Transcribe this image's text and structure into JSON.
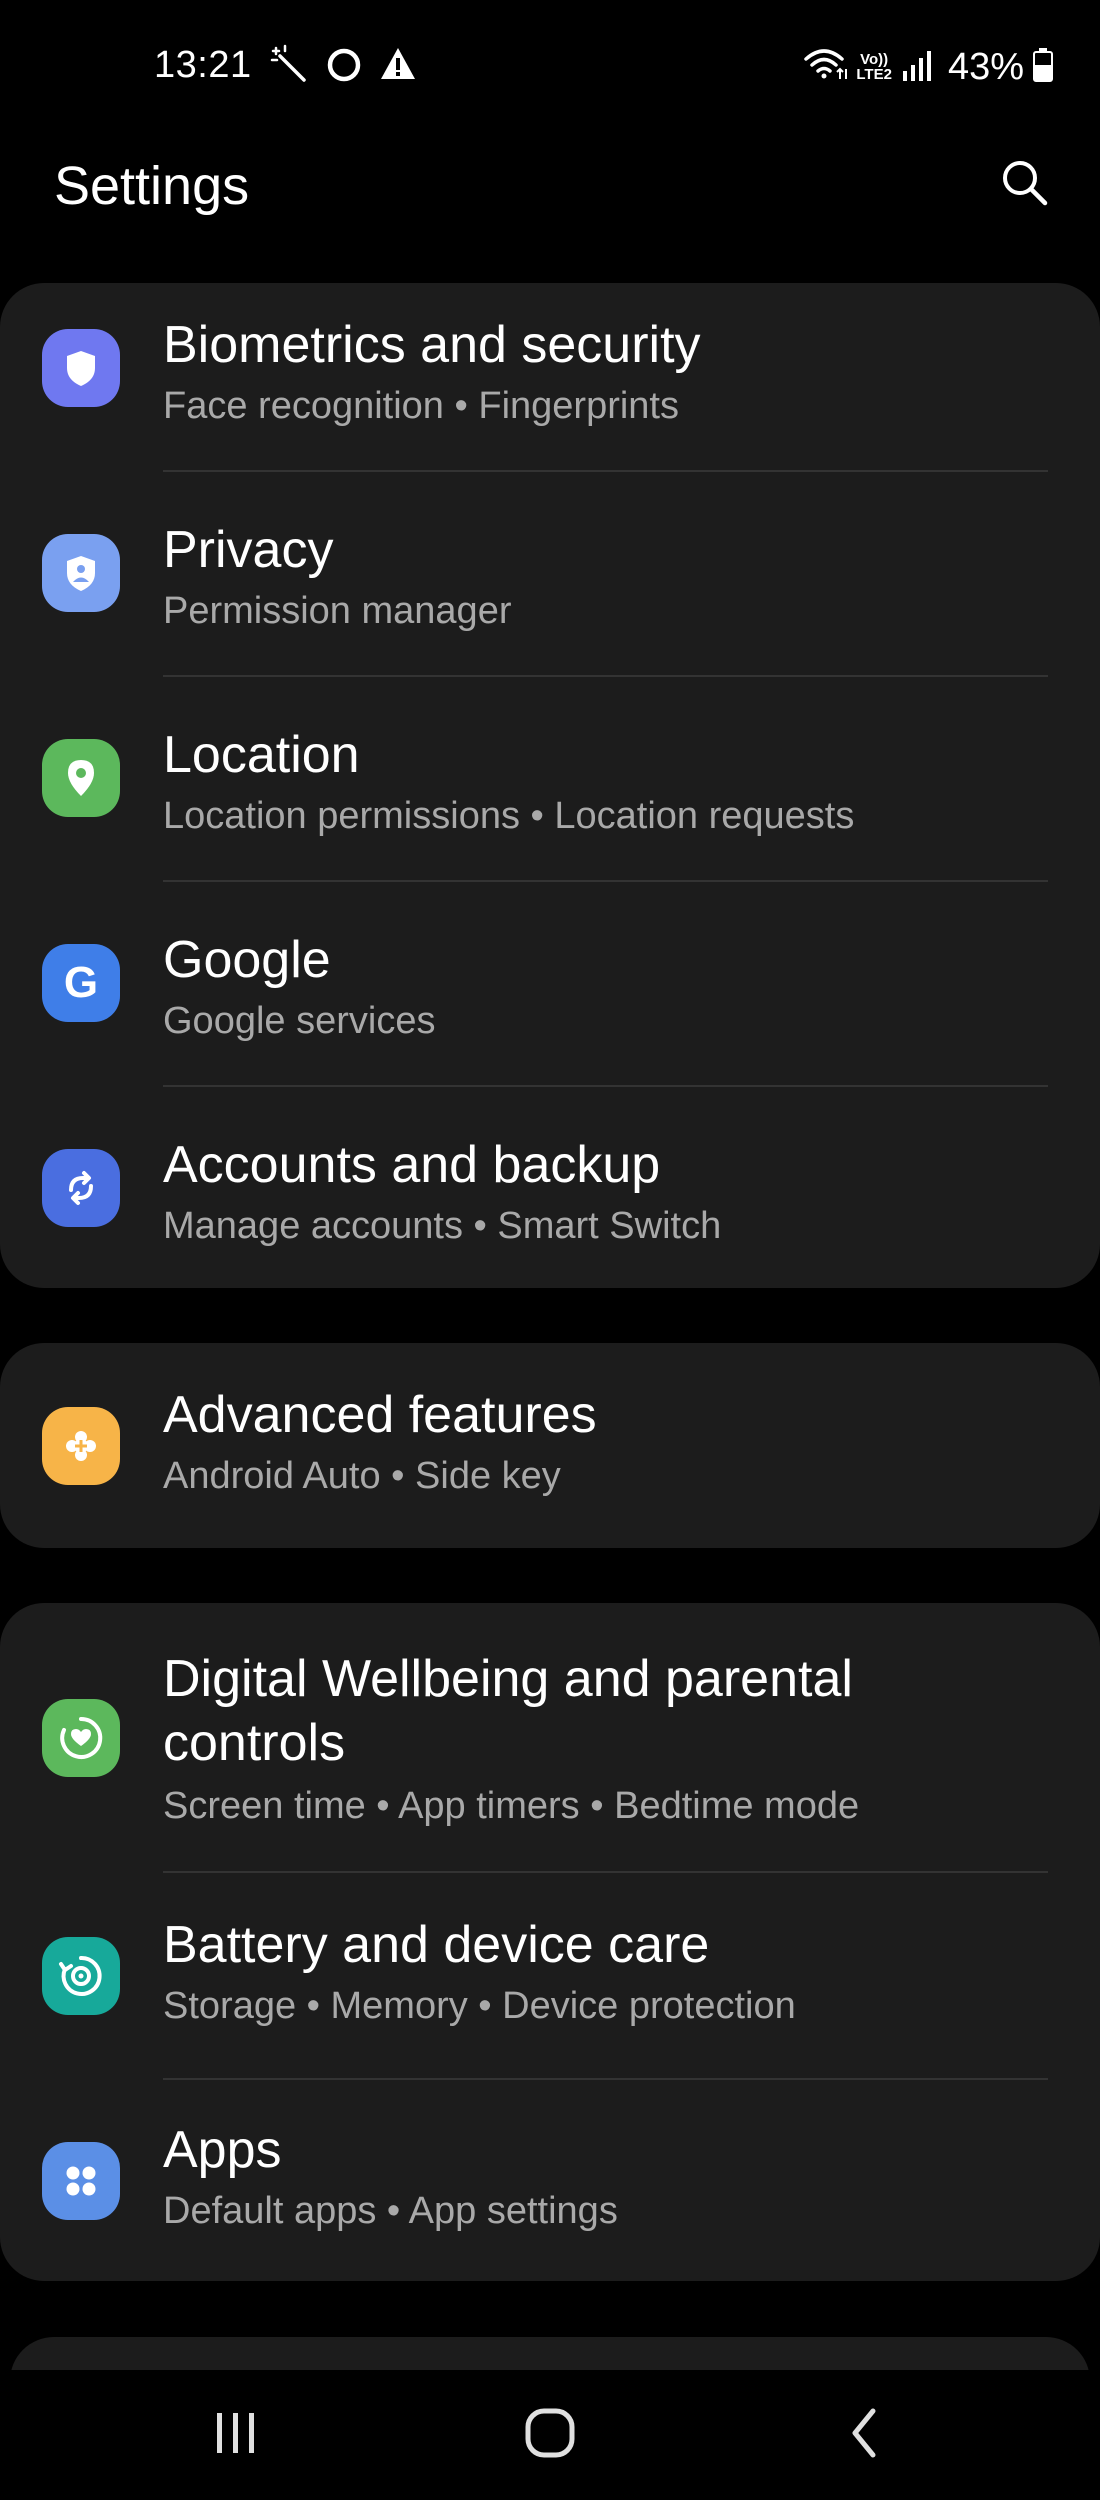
{
  "status_bar": {
    "time": "13:21",
    "battery_percent": "43%",
    "left_icons": [
      "magic-wand-icon",
      "circle-ring-icon",
      "warning-icon"
    ],
    "right_icons": [
      "wifi-icon",
      "volte-lte2-icon",
      "signal-bars-icon",
      "battery-icon"
    ],
    "network_label_top": "Vo))",
    "network_label_bottom": "LTE2"
  },
  "header": {
    "title": "Settings",
    "search_icon": "search-icon"
  },
  "groups": [
    {
      "items": [
        {
          "title": "Biometrics and security",
          "subtitle": "Face recognition  •  Fingerprints",
          "icon": "shield-icon",
          "color": "#6f78f0"
        },
        {
          "title": "Privacy",
          "subtitle": "Permission manager",
          "icon": "privacy-shield-icon",
          "color": "#7aa0f0"
        },
        {
          "title": "Location",
          "subtitle": "Location permissions  •  Location requests",
          "icon": "location-pin-icon",
          "color": "#5cb85c"
        },
        {
          "title": "Google",
          "subtitle": "Google services",
          "icon": "google-icon",
          "color": "#3f7ee8"
        },
        {
          "title": "Accounts and backup",
          "subtitle": "Manage accounts  •  Smart Switch",
          "icon": "sync-icon",
          "color": "#4a6ee0"
        }
      ]
    },
    {
      "items": [
        {
          "title": "Advanced features",
          "subtitle": "Android Auto  •  Side key",
          "icon": "gear-plus-icon",
          "color": "#f7b448"
        }
      ]
    },
    {
      "items": [
        {
          "title": "Digital Wellbeing and parental controls",
          "subtitle": "Screen time  •  App timers  •  Bedtime mode",
          "icon": "heart-circle-icon",
          "color": "#5cb85c"
        },
        {
          "title": "Battery and device care",
          "subtitle": "Storage  •  Memory  •  Device protection",
          "icon": "device-care-icon",
          "color": "#17a99a"
        },
        {
          "title": "Apps",
          "subtitle": "Default apps  •  App settings",
          "icon": "apps-grid-icon",
          "color": "#5b8fe6"
        }
      ]
    }
  ],
  "nav_bar": {
    "recents_icon": "recents-icon",
    "home_icon": "home-icon",
    "back_icon": "back-icon"
  }
}
